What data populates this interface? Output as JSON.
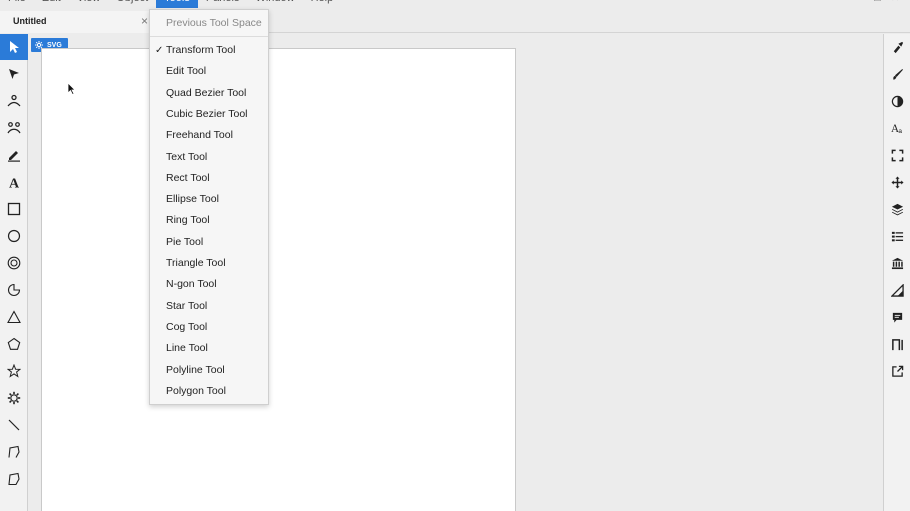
{
  "menubar": {
    "items": [
      "File",
      "Edit",
      "View",
      "Object",
      "Tools",
      "Panels",
      "Window",
      "Help"
    ],
    "active_index": 4
  },
  "window_controls": [
    "minimize",
    "maximize",
    "close"
  ],
  "tab": {
    "title": "Untitled",
    "close": "×"
  },
  "badge": {
    "label": "SVG"
  },
  "tools_menu": {
    "previous_tool": {
      "label": "Previous Tool",
      "shortcut": "Space"
    },
    "items": [
      {
        "label": "Transform Tool",
        "checked": true
      },
      {
        "label": "Edit Tool"
      },
      {
        "label": "Quad Bezier Tool"
      },
      {
        "label": "Cubic Bezier Tool"
      },
      {
        "label": "Freehand Tool"
      },
      {
        "label": "Text Tool"
      },
      {
        "label": "Rect Tool"
      },
      {
        "label": "Ellipse Tool"
      },
      {
        "label": "Ring Tool"
      },
      {
        "label": "Pie Tool"
      },
      {
        "label": "Triangle Tool"
      },
      {
        "label": "N-gon Tool"
      },
      {
        "label": "Star Tool"
      },
      {
        "label": "Cog Tool"
      },
      {
        "label": "Line Tool"
      },
      {
        "label": "Polyline Tool"
      },
      {
        "label": "Polygon Tool"
      }
    ]
  },
  "left_tools": [
    "transform-arrow-icon",
    "edit-arrow-icon",
    "quad-bezier-icon",
    "cubic-bezier-icon",
    "freehand-pencil-icon",
    "text-icon",
    "rect-icon",
    "ellipse-icon",
    "ring-icon",
    "pie-icon",
    "triangle-icon",
    "ngon-icon",
    "star-icon",
    "cog-icon",
    "line-icon",
    "polyline-icon",
    "polygon-icon"
  ],
  "right_panels": [
    "fill-icon",
    "stroke-icon",
    "contrast-icon",
    "font-icon",
    "fullscreen-icon",
    "move-icon",
    "layers-icon",
    "list-icon",
    "library-icon",
    "ruler-icon",
    "comment-icon",
    "path-icon",
    "export-icon"
  ],
  "colors": {
    "accent": "#2b7bd8",
    "background": "#ececec",
    "artboard": "#ffffff"
  }
}
